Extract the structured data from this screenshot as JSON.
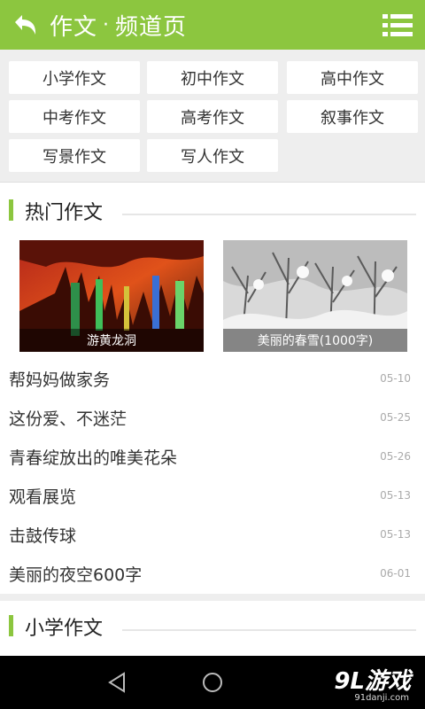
{
  "header": {
    "back_icon": "back-arrow-icon",
    "title_main": "作文",
    "title_sep": "·",
    "title_sub": "频道页",
    "menu_icon": "menu-list-icon",
    "accent": "#8cc63f"
  },
  "categories": [
    "小学作文",
    "初中作文",
    "高中作文",
    "中考作文",
    "高考作文",
    "叙事作文",
    "写景作文",
    "写人作文"
  ],
  "hot": {
    "title": "热门作文",
    "cards": [
      {
        "caption": "游黄龙洞"
      },
      {
        "caption": "美丽的春雪(1000字)"
      }
    ],
    "items": [
      {
        "title": "帮妈妈做家务",
        "date": "05-10"
      },
      {
        "title": "这份爱、不迷茫",
        "date": "05-25"
      },
      {
        "title": "青春绽放出的唯美花朵",
        "date": "05-26"
      },
      {
        "title": "观看展览",
        "date": "05-13"
      },
      {
        "title": "击鼓传球",
        "date": "05-13"
      },
      {
        "title": "美丽的夜空600字",
        "date": "06-01"
      }
    ]
  },
  "primary_section": {
    "title": "小学作文"
  },
  "navbar": {
    "back_icon": "nav-back-triangle-icon",
    "home_icon": "nav-home-circle-icon",
    "watermark_main": "9L游戏",
    "watermark_sub": "91danji.com"
  }
}
